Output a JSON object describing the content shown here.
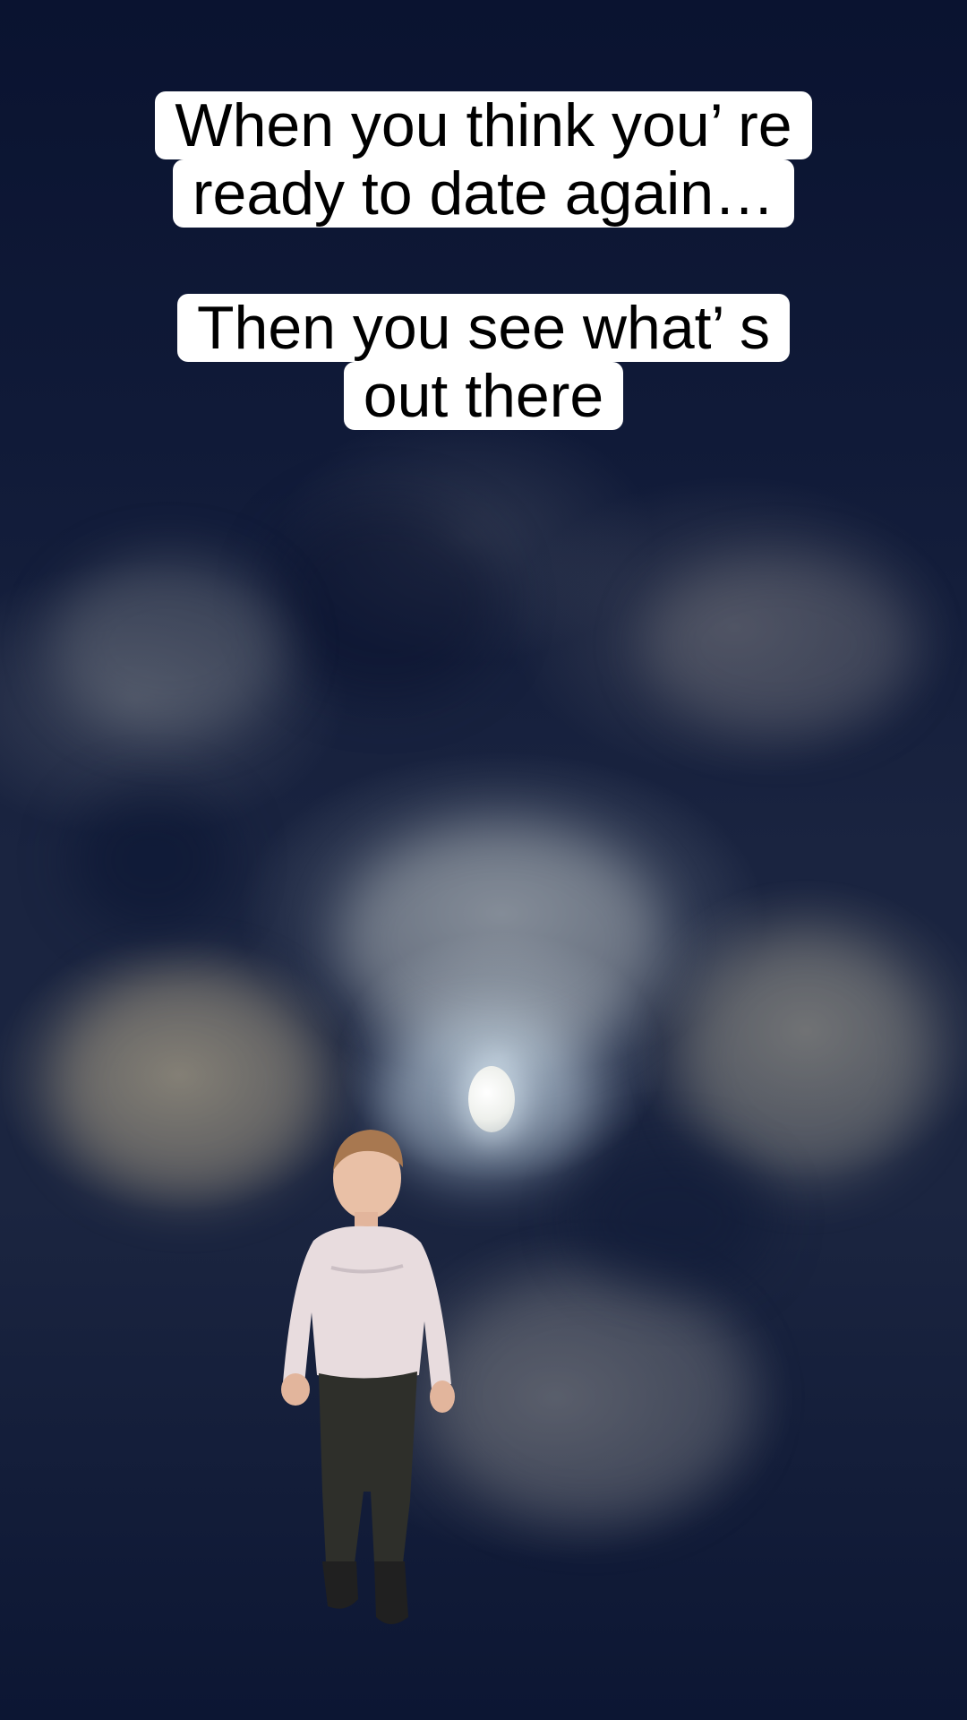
{
  "captions": {
    "caption_1": {
      "line_1": "When you think you’ re",
      "line_2": "ready to date again…"
    },
    "caption_2": {
      "line_1": "Then you see what’ s",
      "line_2": "out there"
    }
  },
  "scene": {
    "background": "night-sky-with-clouds",
    "moon": "moon",
    "figure": "walking-boy"
  },
  "colors": {
    "sky_dark": "#0a1330",
    "caption_bg": "#ffffff",
    "caption_text": "#000000"
  }
}
